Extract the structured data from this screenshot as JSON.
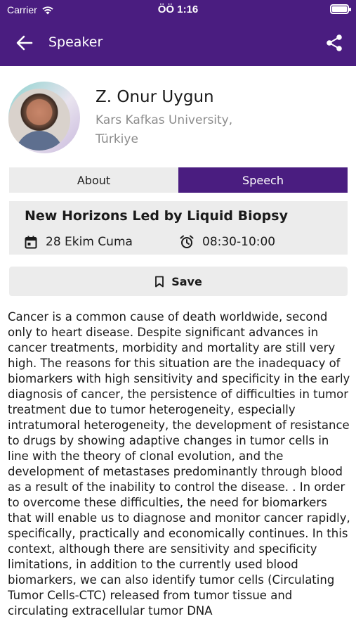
{
  "status_bar": {
    "carrier": "Carrier",
    "time": "ÖÖ 1:16",
    "battery_level": 1.0
  },
  "header": {
    "title": "Speaker",
    "color": "#4a1d80"
  },
  "speaker": {
    "name": "Z. Onur Uygun",
    "affiliation": "Kars Kafkas University, Türkiye"
  },
  "tabs": [
    {
      "label": "About",
      "active": false
    },
    {
      "label": "Speech",
      "active": true
    }
  ],
  "session": {
    "title": "New Horizons Led by Liquid Biopsy",
    "date": "28 Ekim Cuma",
    "time": "08:30-10:00"
  },
  "save_label": "Save",
  "abstract": "Cancer is a common cause of death worldwide, second only to heart disease. Despite significant advances in cancer treatments, morbidity and mortality are still very high. The reasons for this situation are the inadequacy of biomarkers with high sensitivity and specificity in the early diagnosis of cancer, the persistence of difficulties in tumor treatment due to tumor heterogeneity, especially intratumoral heterogeneity, the development of resistance to drugs by showing adaptive changes in tumor cells in line with the theory of clonal evolution, and the development of metastases predominantly through blood as a result of the inability to control the disease. . In order to overcome these difficulties, the need for biomarkers that will enable us to diagnose and monitor cancer rapidly, specifically, practically and economically continues. In this context, although there are sensitivity and specificity limitations, in addition to the currently used blood biomarkers, we can also identify tumor cells (Circulating Tumor Cells-CTC) released from tumor tissue and circulating extracellular tumor DNA"
}
